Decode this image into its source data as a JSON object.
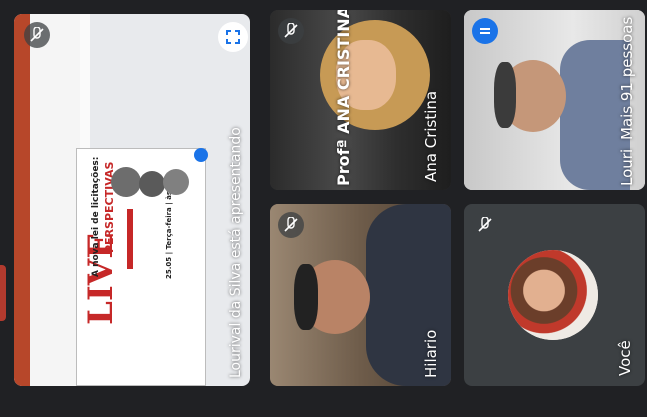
{
  "tiles": {
    "presenter": {
      "label": "Lourival da Silva está apresentando"
    },
    "slide": {
      "live": "LIVE",
      "title_line1": "A nova lei de licitações:",
      "title_line2": "PERSPECTIVAS",
      "date": "25.05 | Terça-feira | às 19h"
    },
    "ana": {
      "name": "Ana Cristina",
      "backdrop_text": "Profª ANA CRISTINA"
    },
    "louri": {
      "name": "Louri",
      "more": "Mais 91 pessoas"
    },
    "hilario": {
      "name": "Hilario"
    },
    "you": {
      "name": "Você"
    }
  },
  "colors": {
    "background": "#202124",
    "tile": "#3c4043",
    "accent_blue": "#1a73e8",
    "slide_red": "#c62828"
  }
}
